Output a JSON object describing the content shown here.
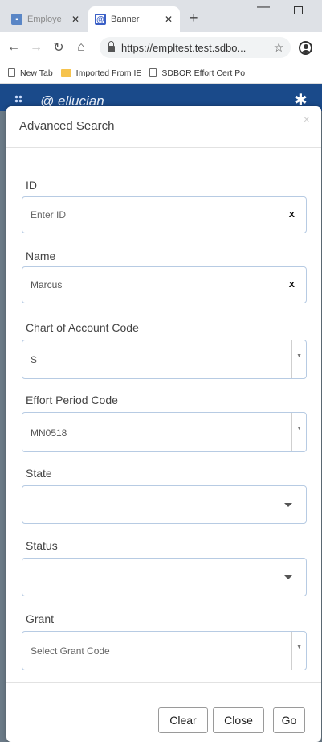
{
  "browser": {
    "tabs": [
      {
        "title": "Employe",
        "active": false
      },
      {
        "title": "Banner",
        "active": true
      }
    ],
    "url": "https://empltest.test.sdbo...",
    "bookmarks": [
      {
        "label": "New Tab",
        "icon": "page-icon"
      },
      {
        "label": "Imported From IE",
        "icon": "folder-icon"
      },
      {
        "label": "SDBOR Effort Cert Po",
        "icon": "page-icon"
      }
    ]
  },
  "app": {
    "logo_text": "ellucian"
  },
  "modal": {
    "title": "Advanced Search",
    "fields": {
      "id": {
        "label": "ID",
        "placeholder": "Enter ID"
      },
      "name": {
        "label": "Name",
        "value": "Marcus"
      },
      "chart": {
        "label": "Chart of Account Code",
        "value": "S"
      },
      "effort": {
        "label": "Effort Period Code",
        "value": "MN0518"
      },
      "state": {
        "label": "State",
        "value": ""
      },
      "status": {
        "label": "Status",
        "value": ""
      },
      "grant": {
        "label": "Grant",
        "placeholder": "Select Grant Code"
      }
    },
    "buttons": {
      "clear": "Clear",
      "close": "Close",
      "go": "Go"
    }
  },
  "colors": {
    "app_header": "#1a4a8a",
    "field_border": "#b7cbe3"
  }
}
